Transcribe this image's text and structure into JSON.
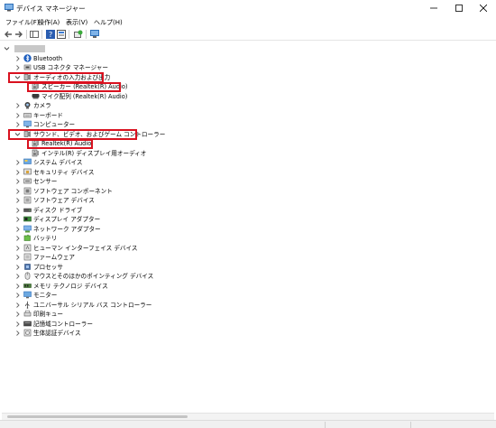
{
  "window": {
    "title": "デバイス マネージャー"
  },
  "menu": [
    {
      "label": "ファイル(F)"
    },
    {
      "label": "操作(A)"
    },
    {
      "label": "表示(V)"
    },
    {
      "label": "ヘルプ(H)"
    }
  ],
  "tree": {
    "items": [
      {
        "label": "Bluetooth",
        "icon": "bluetooth-icon",
        "expanded": false
      },
      {
        "label": "USB コネクタ マネージャー",
        "icon": "usb-connector-icon",
        "expanded": false
      },
      {
        "label": "オーディオの入力および出力",
        "icon": "audio-io-icon",
        "expanded": true
      },
      {
        "label": "スピーカー (Realtek(R) Audio)",
        "icon": "speaker-icon",
        "child": true
      },
      {
        "label": "マイク配列 (Realtek(R) Audio)",
        "icon": "microphone-icon",
        "child": true
      },
      {
        "label": "カメラ",
        "icon": "camera-icon",
        "expanded": false
      },
      {
        "label": "キーボード",
        "icon": "keyboard-icon",
        "expanded": false
      },
      {
        "label": "コンピューター",
        "icon": "computer-icon",
        "expanded": false
      },
      {
        "label": "サウンド、ビデオ、およびゲーム コントローラー",
        "icon": "sound-video-icon",
        "expanded": true
      },
      {
        "label": "Realtek(R) Audio",
        "icon": "speaker-icon",
        "child": true
      },
      {
        "label": "インテル(R) ディスプレイ用オーディオ",
        "icon": "speaker-icon",
        "child": true
      },
      {
        "label": "システム デバイス",
        "icon": "system-device-icon",
        "expanded": false
      },
      {
        "label": "セキュリティ デバイス",
        "icon": "security-device-icon",
        "expanded": false
      },
      {
        "label": "センサー",
        "icon": "sensor-icon",
        "expanded": false
      },
      {
        "label": "ソフトウェア コンポーネント",
        "icon": "software-component-icon",
        "expanded": false
      },
      {
        "label": "ソフトウェア デバイス",
        "icon": "software-device-icon",
        "expanded": false
      },
      {
        "label": "ディスク ドライブ",
        "icon": "disk-drive-icon",
        "expanded": false
      },
      {
        "label": "ディスプレイ アダプター",
        "icon": "display-adapter-icon",
        "expanded": false
      },
      {
        "label": "ネットワーク アダプター",
        "icon": "network-adapter-icon",
        "expanded": false
      },
      {
        "label": "バッテリ",
        "icon": "battery-icon",
        "expanded": false
      },
      {
        "label": "ヒューマン インターフェイス デバイス",
        "icon": "hid-icon",
        "expanded": false
      },
      {
        "label": "ファームウェア",
        "icon": "firmware-icon",
        "expanded": false
      },
      {
        "label": "プロセッサ",
        "icon": "processor-icon",
        "expanded": false
      },
      {
        "label": "マウスとそのほかのポインティング デバイス",
        "icon": "mouse-icon",
        "expanded": false
      },
      {
        "label": "メモリ テクノロジ デバイス",
        "icon": "memory-icon",
        "expanded": false
      },
      {
        "label": "モニター",
        "icon": "monitor-icon",
        "expanded": false
      },
      {
        "label": "ユニバーサル シリアル バス コントローラー",
        "icon": "usb-controller-icon",
        "expanded": false
      },
      {
        "label": "印刷キュー",
        "icon": "print-queue-icon",
        "expanded": false
      },
      {
        "label": "記憶域コントローラー",
        "icon": "storage-controller-icon",
        "expanded": false
      },
      {
        "label": "生体認証デバイス",
        "icon": "biometric-icon",
        "expanded": false
      }
    ]
  },
  "colors": {
    "highlight": "#d9111f",
    "accent": "#0067c0"
  }
}
